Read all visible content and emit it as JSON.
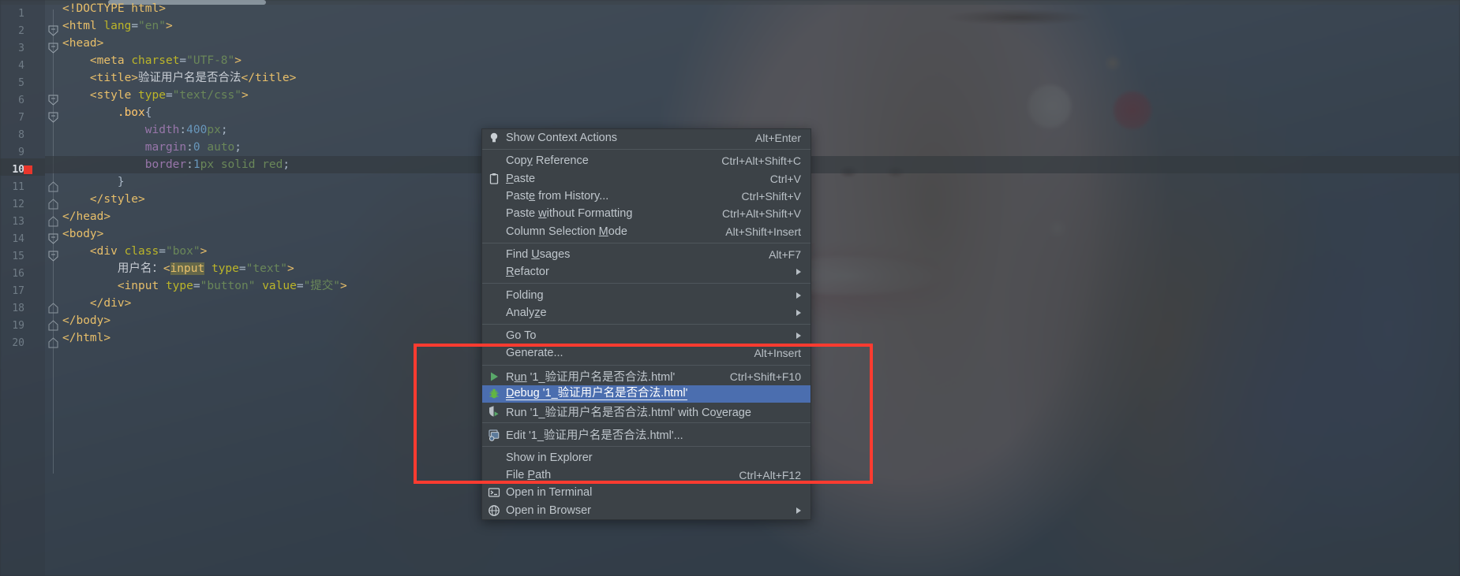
{
  "editor": {
    "scrollbar": "horizontal-scrollbar",
    "active_line": 10,
    "breakpoint_line": 10,
    "lines": [
      {
        "n": "1",
        "fold": "",
        "indent": 0,
        "tokens": [
          {
            "t": "tag",
            "v": "<!DOCTYPE html>"
          }
        ]
      },
      {
        "n": "2",
        "fold": "open",
        "indent": 0,
        "tokens": [
          {
            "t": "tag",
            "v": "<html "
          },
          {
            "t": "attr",
            "v": "lang"
          },
          {
            "t": "pln",
            "v": "="
          },
          {
            "t": "str",
            "v": "\"en\""
          },
          {
            "t": "tag",
            "v": ">"
          }
        ]
      },
      {
        "n": "3",
        "fold": "open",
        "indent": 0,
        "tokens": [
          {
            "t": "tag",
            "v": "<head>"
          }
        ]
      },
      {
        "n": "4",
        "fold": "",
        "indent": 1,
        "tokens": [
          {
            "t": "tag",
            "v": "<meta "
          },
          {
            "t": "attr",
            "v": "charset"
          },
          {
            "t": "pln",
            "v": "="
          },
          {
            "t": "str",
            "v": "\"UTF-8\""
          },
          {
            "t": "tag",
            "v": ">"
          }
        ]
      },
      {
        "n": "5",
        "fold": "",
        "indent": 1,
        "tokens": [
          {
            "t": "tag",
            "v": "<title>"
          },
          {
            "t": "txt",
            "v": "验证用户名是否合法"
          },
          {
            "t": "tag",
            "v": "</title>"
          }
        ]
      },
      {
        "n": "6",
        "fold": "open",
        "indent": 1,
        "tokens": [
          {
            "t": "tag",
            "v": "<style "
          },
          {
            "t": "attr",
            "v": "type"
          },
          {
            "t": "pln",
            "v": "="
          },
          {
            "t": "str",
            "v": "\"text/css\""
          },
          {
            "t": "tag",
            "v": ">"
          }
        ]
      },
      {
        "n": "7",
        "fold": "open",
        "indent": 2,
        "tokens": [
          {
            "t": "sel",
            "v": ".box"
          },
          {
            "t": "brc",
            "v": "{"
          }
        ]
      },
      {
        "n": "8",
        "fold": "",
        "indent": 3,
        "tokens": [
          {
            "t": "prop",
            "v": "width"
          },
          {
            "t": "pln",
            "v": ":"
          },
          {
            "t": "num",
            "v": "400"
          },
          {
            "t": "str",
            "v": "px"
          },
          {
            "t": "pln",
            "v": ";"
          }
        ]
      },
      {
        "n": "9",
        "fold": "",
        "indent": 3,
        "tokens": [
          {
            "t": "prop",
            "v": "margin"
          },
          {
            "t": "pln",
            "v": ":"
          },
          {
            "t": "num",
            "v": "0"
          },
          {
            "t": "pln",
            "v": " "
          },
          {
            "t": "str",
            "v": "auto"
          },
          {
            "t": "pln",
            "v": ";"
          }
        ]
      },
      {
        "n": "10",
        "fold": "",
        "indent": 3,
        "tokens": [
          {
            "t": "prop",
            "v": "border"
          },
          {
            "t": "pln",
            "v": ":"
          },
          {
            "t": "num",
            "v": "1"
          },
          {
            "t": "str",
            "v": "px solid "
          },
          {
            "t": "str",
            "v": "red"
          },
          {
            "t": "pln",
            "v": ";"
          }
        ]
      },
      {
        "n": "11",
        "fold": "close",
        "indent": 2,
        "tokens": [
          {
            "t": "brc",
            "v": "}"
          }
        ]
      },
      {
        "n": "12",
        "fold": "close",
        "indent": 1,
        "tokens": [
          {
            "t": "tag",
            "v": "</style>"
          }
        ]
      },
      {
        "n": "13",
        "fold": "close",
        "indent": 0,
        "tokens": [
          {
            "t": "tag",
            "v": "</head>"
          }
        ]
      },
      {
        "n": "14",
        "fold": "open",
        "indent": 0,
        "tokens": [
          {
            "t": "tag",
            "v": "<body>"
          }
        ]
      },
      {
        "n": "15",
        "fold": "open",
        "indent": 1,
        "tokens": [
          {
            "t": "tag",
            "v": "<div "
          },
          {
            "t": "attr",
            "v": "class"
          },
          {
            "t": "pln",
            "v": "="
          },
          {
            "t": "str",
            "v": "\"box\""
          },
          {
            "t": "tag",
            "v": ">"
          }
        ]
      },
      {
        "n": "16",
        "fold": "",
        "indent": 2,
        "tokens": [
          {
            "t": "txt",
            "v": "用户名："
          },
          {
            "t": "tag",
            "v": "<"
          },
          {
            "t": "tag hl",
            "v": "input"
          },
          {
            "t": "pln",
            "v": " "
          },
          {
            "t": "attr",
            "v": "type"
          },
          {
            "t": "pln",
            "v": "="
          },
          {
            "t": "str",
            "v": "\"text\""
          },
          {
            "t": "tag",
            "v": ">"
          }
        ]
      },
      {
        "n": "17",
        "fold": "",
        "indent": 2,
        "tokens": [
          {
            "t": "tag",
            "v": "<input "
          },
          {
            "t": "attr",
            "v": "type"
          },
          {
            "t": "pln",
            "v": "="
          },
          {
            "t": "str",
            "v": "\"button\""
          },
          {
            "t": "pln",
            "v": " "
          },
          {
            "t": "attr",
            "v": "value"
          },
          {
            "t": "pln",
            "v": "="
          },
          {
            "t": "str",
            "v": "\"提交\""
          },
          {
            "t": "tag",
            "v": ">"
          }
        ]
      },
      {
        "n": "18",
        "fold": "close",
        "indent": 1,
        "tokens": [
          {
            "t": "tag",
            "v": "</div>"
          }
        ]
      },
      {
        "n": "19",
        "fold": "close",
        "indent": 0,
        "tokens": [
          {
            "t": "tag",
            "v": "</body>"
          }
        ]
      },
      {
        "n": "20",
        "fold": "close",
        "indent": 0,
        "tokens": [
          {
            "t": "tag",
            "v": "</html>"
          }
        ]
      }
    ]
  },
  "context_menu": {
    "selected_item": "Debug '1_验证用户名是否合法.html'",
    "items": [
      {
        "kind": "item",
        "name": "show-context-actions",
        "icon": "lightbulb-icon",
        "label": "Show Context Actions",
        "mnemonic": "",
        "shortcut": "Alt+Enter"
      },
      {
        "kind": "sep"
      },
      {
        "kind": "item",
        "name": "copy-reference",
        "icon": "",
        "label": "Copy Reference",
        "mnemonic": "y",
        "shortcut": "Ctrl+Alt+Shift+C"
      },
      {
        "kind": "item",
        "name": "paste",
        "icon": "clipboard-icon",
        "label": "Paste",
        "mnemonic": "P",
        "shortcut": "Ctrl+V"
      },
      {
        "kind": "item",
        "name": "paste-from-history",
        "icon": "",
        "label": "Paste from History...",
        "mnemonic": "e",
        "shortcut": "Ctrl+Shift+V"
      },
      {
        "kind": "item",
        "name": "paste-without-formatting",
        "icon": "",
        "label": "Paste without Formatting",
        "mnemonic": "w",
        "shortcut": "Ctrl+Alt+Shift+V"
      },
      {
        "kind": "item",
        "name": "column-selection-mode",
        "icon": "",
        "label": "Column Selection Mode",
        "mnemonic": "M",
        "shortcut": "Alt+Shift+Insert"
      },
      {
        "kind": "sep"
      },
      {
        "kind": "item",
        "name": "find-usages",
        "icon": "",
        "label": "Find Usages",
        "mnemonic": "U",
        "shortcut": "Alt+F7"
      },
      {
        "kind": "submenu",
        "name": "refactor",
        "icon": "",
        "label": "Refactor",
        "mnemonic": "R",
        "shortcut": ""
      },
      {
        "kind": "sep"
      },
      {
        "kind": "submenu",
        "name": "folding",
        "icon": "",
        "label": "Folding",
        "mnemonic": "",
        "shortcut": ""
      },
      {
        "kind": "submenu",
        "name": "analyze",
        "icon": "",
        "label": "Analyze",
        "mnemonic": "z",
        "shortcut": ""
      },
      {
        "kind": "sep"
      },
      {
        "kind": "submenu",
        "name": "go-to",
        "icon": "",
        "label": "Go To",
        "mnemonic": "",
        "shortcut": ""
      },
      {
        "kind": "item",
        "name": "generate",
        "icon": "",
        "label": "Generate...",
        "mnemonic": "",
        "shortcut": "Alt+Insert"
      },
      {
        "kind": "sep"
      },
      {
        "kind": "item",
        "name": "run-file",
        "icon": "run-green-triangle-icon",
        "label": "Run '1_验证用户名是否合法.html'",
        "mnemonic": "un",
        "shortcut": "Ctrl+Shift+F10"
      },
      {
        "kind": "item",
        "name": "debug-file",
        "icon": "debug-bug-icon",
        "label": "Debug '1_验证用户名是否合法.html'",
        "mnemonic": "D",
        "shortcut": "",
        "selected": true
      },
      {
        "kind": "item",
        "name": "run-with-coverage",
        "icon": "coverage-shield-icon",
        "label": "Run '1_验证用户名是否合法.html' with Coverage",
        "mnemonic": "v",
        "shortcut": ""
      },
      {
        "kind": "sep"
      },
      {
        "kind": "item",
        "name": "edit-run-configuration",
        "icon": "edit-config-icon",
        "label": "Edit '1_验证用户名是否合法.html'...",
        "mnemonic": "",
        "shortcut": ""
      },
      {
        "kind": "sep"
      },
      {
        "kind": "item",
        "name": "show-in-explorer",
        "icon": "",
        "label": "Show in Explorer",
        "mnemonic": "",
        "shortcut": ""
      },
      {
        "kind": "item",
        "name": "file-path",
        "icon": "",
        "label": "File Path",
        "mnemonic": "P",
        "shortcut": "Ctrl+Alt+F12"
      },
      {
        "kind": "item",
        "name": "open-in-terminal",
        "icon": "terminal-icon",
        "label": "Open in Terminal",
        "mnemonic": "",
        "shortcut": ""
      },
      {
        "kind": "submenu",
        "name": "open-in-browser",
        "icon": "browser-globe-icon",
        "label": "Open in Browser",
        "mnemonic": "",
        "shortcut": ""
      }
    ]
  },
  "annotation": {
    "name": "red-highlight-rectangle",
    "color": "#ff3b30"
  },
  "colors": {
    "menu_bg": "#3c4247",
    "menu_selected": "#4b6eaf",
    "breakpoint": "#e8362c",
    "annotation": "#ff3b30",
    "tag": "#e8bf6a",
    "attr": "#bbb529",
    "string": "#6a8759",
    "number": "#6897bb"
  }
}
